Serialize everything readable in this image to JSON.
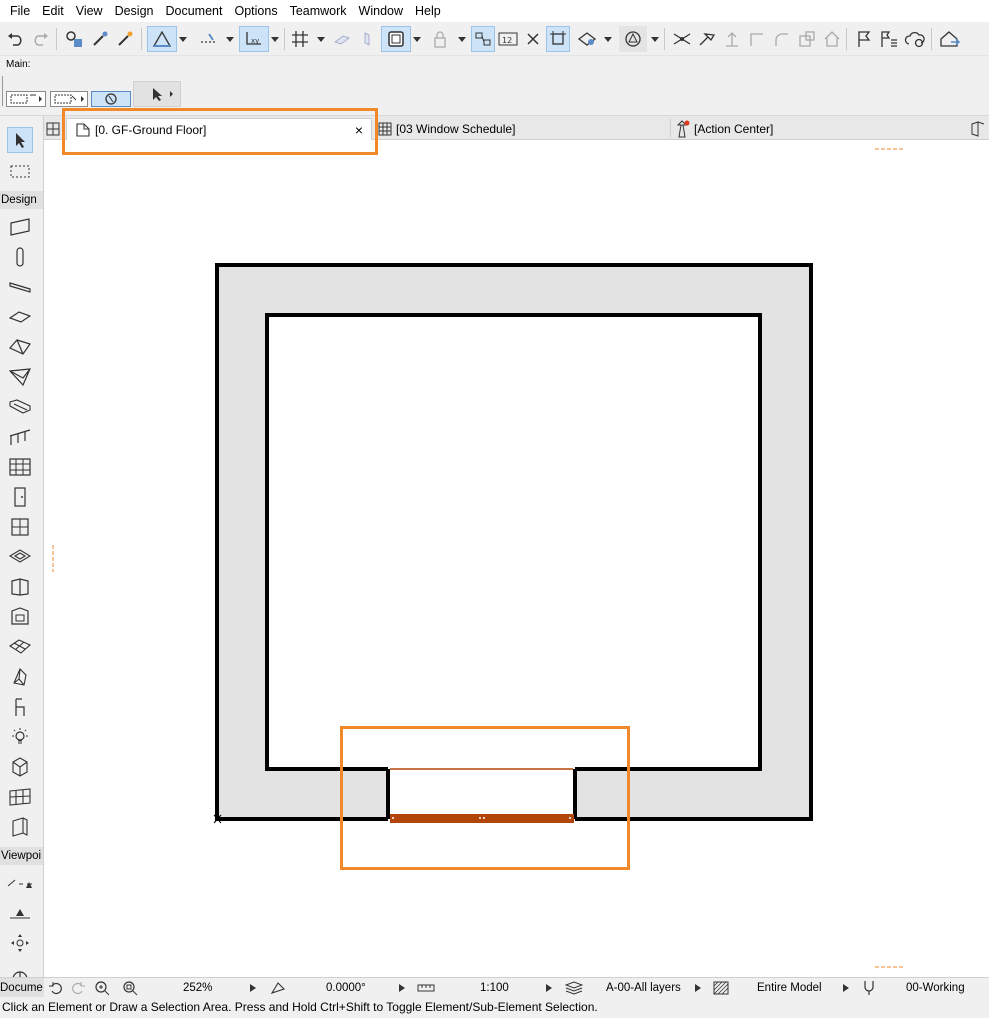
{
  "menu": [
    "File",
    "Edit",
    "View",
    "Design",
    "Document",
    "Options",
    "Teamwork",
    "Window",
    "Help"
  ],
  "infobox": {
    "label": "Main:"
  },
  "toolbox": {
    "design_section": "Design",
    "viewpoint_section": "Viewpoi",
    "document_section": "Docume"
  },
  "tabs": [
    {
      "label": "[0. GF-Ground Floor]",
      "close": "×"
    },
    {
      "label": "[03 Window Schedule]"
    },
    {
      "label": "[Action Center]"
    }
  ],
  "navbar": {
    "zoom": "252%",
    "angle": "0.0000°",
    "scale": "1:100",
    "layers": "A-00-All layers",
    "model_view": "Entire Model",
    "pen_set": "00-Working"
  },
  "status_message": "Click an Element or Draw a Selection Area. Press and Hold Ctrl+Shift to Toggle Element/Sub-Element Selection.",
  "colors": {
    "highlight": "#f0892a",
    "wall_fill": "#e3e3e3",
    "window_selected": "#b2450a",
    "active_tool_bg": "#cde3f7"
  }
}
